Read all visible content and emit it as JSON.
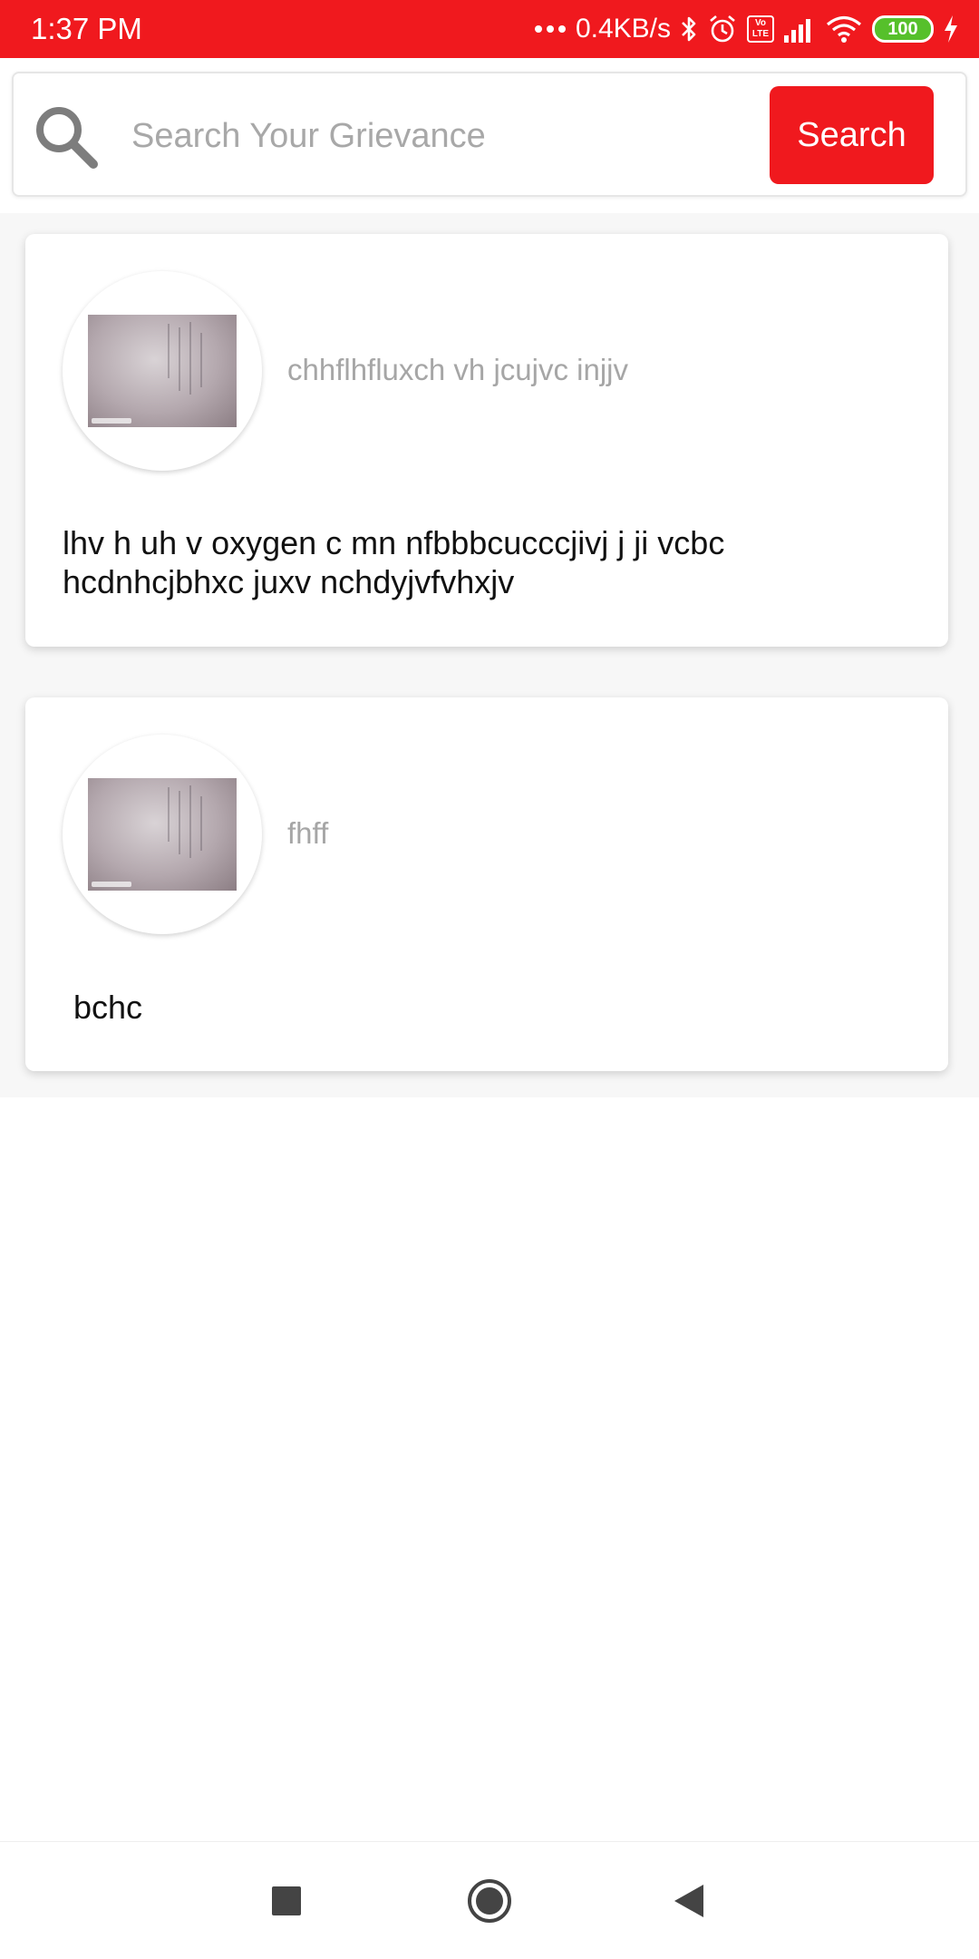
{
  "status_bar": {
    "time": "1:37 PM",
    "network_speed": "0.4KB/s",
    "battery_level": "100",
    "volte_label": "Vo LTE",
    "background_color": "#f0191e"
  },
  "search": {
    "placeholder": "Search Your Grievance",
    "value": "",
    "button_label": "Search",
    "icon": "search-icon"
  },
  "grievances": [
    {
      "title": "chhflhfluxch vh jcujvc  injjv",
      "description": "lhv h uh v oxygen c mn nfbbbcucccjivj j ji  vcbc hcdnhcjbhxc juxv nchdyjvfvhxjv",
      "thumbnail": "document-photo"
    },
    {
      "title": "fhff",
      "description": "bchc",
      "thumbnail": "document-photo"
    }
  ],
  "nav": {
    "recents": "square-icon",
    "home": "circle-icon",
    "back": "triangle-icon"
  },
  "colors": {
    "accent": "#f0191e",
    "title_gray": "#a6a6a6",
    "battery_green": "#56c02b"
  }
}
